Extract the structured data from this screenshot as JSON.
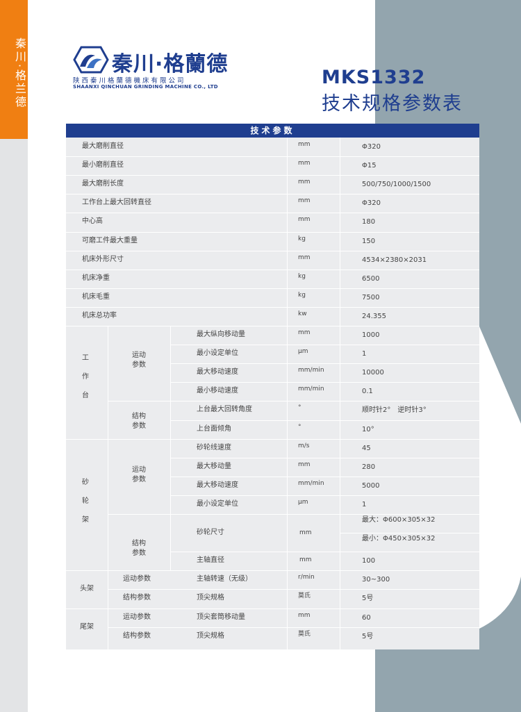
{
  "sidebar": {
    "brand": "秦川·格兰德"
  },
  "logo": {
    "name": "秦川·格蘭德",
    "company_cn": "陕西秦川格蘭德機床有限公司",
    "company_en": "SHAANXI QINCHUAN GRINDING MACHINE CO., LTD"
  },
  "header": {
    "model": "MKS1332",
    "title": "技术规格参数表"
  },
  "colors": {
    "brand_blue": "#1f3e8f",
    "accent_orange": "#f07f12",
    "slate": "#93a5ae",
    "table_bg": "#ebecee"
  },
  "table": {
    "header": "技术参数",
    "simple_rows": [
      {
        "name": "最大磨削直径",
        "unit": "mm",
        "value": "Φ320"
      },
      {
        "name": "最小磨削直径",
        "unit": "mm",
        "value": "Φ15"
      },
      {
        "name": "最大磨削长度",
        "unit": "mm",
        "value": "500/750/1000/1500"
      },
      {
        "name": "工作台上最大回转直径",
        "unit": "mm",
        "value": "Φ320"
      },
      {
        "name": "中心高",
        "unit": "mm",
        "value": "180"
      },
      {
        "name": "可磨工件最大重量",
        "unit": "kg",
        "value": "150"
      },
      {
        "name": "机床外形尺寸",
        "unit": "mm",
        "value": "4534×2380×2031"
      },
      {
        "name": "机床净重",
        "unit": "kg",
        "value": "6500"
      },
      {
        "name": "机床毛重",
        "unit": "kg",
        "value": "7500"
      },
      {
        "name": "机床总功率",
        "unit": "kw",
        "value": "24.355"
      }
    ],
    "worktable": {
      "group": [
        "工",
        "作",
        "台"
      ],
      "motion_label": [
        "运动",
        "参数"
      ],
      "motion_rows": [
        {
          "name": "最大纵向移动量",
          "unit": "mm",
          "value": "1000"
        },
        {
          "name": "最小设定单位",
          "unit": "μm",
          "value": "1"
        },
        {
          "name": "最大移动速度",
          "unit": "mm/min",
          "value": "10000"
        },
        {
          "name": "最小移动速度",
          "unit": "mm/min",
          "value": "0.1"
        }
      ],
      "struct_label": [
        "结构",
        "参数"
      ],
      "struct_rows": [
        {
          "name": "上台最大回转角度",
          "unit": "°",
          "value": "顺时针2°　逆时针3°"
        },
        {
          "name": "上台面倾角",
          "unit": "°",
          "value": "10°"
        }
      ]
    },
    "wheelhead": {
      "group": [
        "砂",
        "轮",
        "架"
      ],
      "motion_label": [
        "运动",
        "参数"
      ],
      "motion_rows": [
        {
          "name": "砂轮线速度",
          "unit": "m/s",
          "value": "45"
        },
        {
          "name": "最大移动量",
          "unit": "mm",
          "value": "280"
        },
        {
          "name": "最大移动速度",
          "unit": "mm/min",
          "value": "5000"
        },
        {
          "name": "最小设定单位",
          "unit": "μm",
          "value": "1"
        }
      ],
      "struct_label": [
        "结构",
        "参数"
      ],
      "wheel_size": {
        "name": "砂轮尺寸",
        "unit": "mm",
        "max": "最大：Φ600×305×32",
        "min": "最小：Φ450×305×32"
      },
      "spindle": {
        "name": "主轴直径",
        "unit": "mm",
        "value": "100"
      }
    },
    "headstock": {
      "group": "头架",
      "rows": [
        {
          "label": "运动参数",
          "name": "主轴转速（无级）",
          "unit": "r/min",
          "value": "30~300"
        },
        {
          "label": "结构参数",
          "name": "顶尖规格",
          "unit": "莫氏",
          "value": "5号"
        }
      ]
    },
    "tailstock": {
      "group": "尾架",
      "rows": [
        {
          "label": "运动参数",
          "name": "顶尖套筒移动量",
          "unit": "mm",
          "value": "60"
        },
        {
          "label": "结构参数",
          "name": "顶尖规格",
          "unit": "莫氏",
          "value": "5号"
        }
      ]
    }
  }
}
